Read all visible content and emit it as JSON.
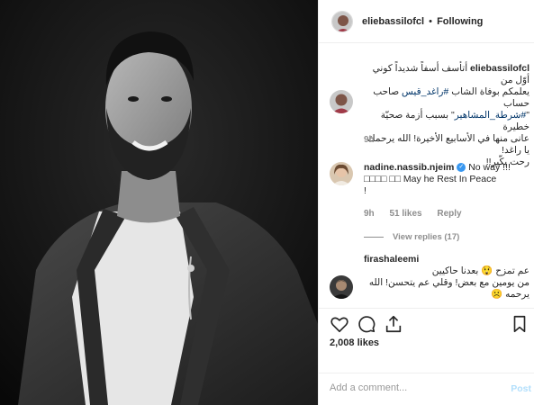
{
  "post": {
    "author": "eliebassilofcl",
    "separator": "•",
    "follow_status": "Following"
  },
  "caption": {
    "username": "eliebassilofcl",
    "line1": "أتأسف أسفاً شديداً كوني أوّل من",
    "line2_prefix": "يعلمكم بوفاة الشاب",
    "hashtag": "#راغد_قيس",
    "line2_suffix": "صاحب حساب",
    "quote_open": "\"",
    "tag2": "#شرطة_المشاهير",
    "line3_suffix": "\" بسبب أزمة صحيّة خطيرة",
    "line4": "عانى منها في الأسابيع الأخيرة! الله يرحمك يا راغد!",
    "line5": "رحت بكّير!!",
    "time": "9h"
  },
  "comment1": {
    "username": "nadine.nassib.njeim",
    "verified_icon": "verified-badge-icon",
    "text1": "No way !!!",
    "text2": "□□□□ □□ May he Rest In Peace",
    "text3": "!",
    "time": "9h",
    "likes": "51 likes",
    "reply": "Reply",
    "view_replies": "View replies (17)"
  },
  "comment2": {
    "username": "firashaleemi",
    "text1": "عم تمزح 😲 بعدنا حاكيين",
    "text2": "من يومين مع بعض! وقلي عم يتحسن! الله",
    "text3": "يرحمه ☹️"
  },
  "engagement": {
    "likes": "2,008 likes",
    "icons": [
      "heart-icon",
      "comment-icon",
      "share-icon",
      "bookmark-icon"
    ]
  },
  "composer": {
    "placeholder": "Add a comment...",
    "post_label": "Post"
  },
  "colors": {
    "link": "#003569",
    "post_disabled": "#b2dffc",
    "muted": "#8e8e8e",
    "verified": "#3897f0"
  }
}
